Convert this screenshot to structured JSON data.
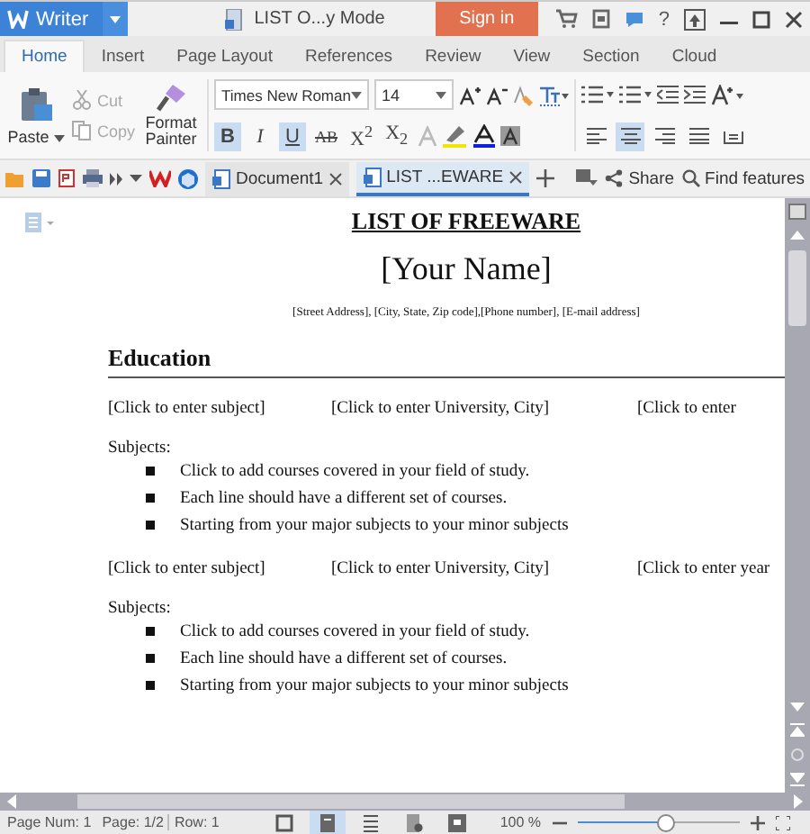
{
  "app": {
    "name": "Writer"
  },
  "title": "LIST O...y Mode",
  "sign_in": "Sign in",
  "help": "?",
  "ribbon_tabs": [
    {
      "label": "Home",
      "selected": true
    },
    {
      "label": "Insert",
      "selected": false
    },
    {
      "label": "Page Layout",
      "selected": false
    },
    {
      "label": "References",
      "selected": false
    },
    {
      "label": "Review",
      "selected": false
    },
    {
      "label": "View",
      "selected": false
    },
    {
      "label": "Section",
      "selected": false
    },
    {
      "label": "Cloud",
      "selected": false
    }
  ],
  "clipboard": {
    "paste": "Paste",
    "cut": {
      "label": "Cut",
      "disabled": true
    },
    "copy": {
      "label": "Copy",
      "disabled": true
    },
    "format_painter": "Format Painter"
  },
  "font": {
    "name": "Times New Roman",
    "size": "14"
  },
  "format_toggles": [
    {
      "kind": "bold",
      "label": "B",
      "selected": true
    },
    {
      "kind": "italic",
      "label": "I",
      "selected": false
    },
    {
      "kind": "underline",
      "label": "U",
      "selected": true
    },
    {
      "kind": "strike",
      "label": "AB",
      "selected": false
    },
    {
      "kind": "superscript",
      "label": "X$^{2}$",
      "selected": false
    },
    {
      "kind": "subscript",
      "label": "X$_{2}$",
      "selected": false
    }
  ],
  "alignment": [
    {
      "kind": "left",
      "selected": false
    },
    {
      "kind": "center",
      "selected": true
    },
    {
      "kind": "right",
      "selected": false
    },
    {
      "kind": "justify",
      "selected": false
    },
    {
      "kind": "distributed",
      "selected": false
    }
  ],
  "doc_tabs": [
    {
      "label": "Document1",
      "selected": false
    },
    {
      "label": "LIST ...EWARE",
      "selected": true
    }
  ],
  "share": "Share",
  "find": "Find features",
  "document": {
    "title": "LIST OF FREEWARE",
    "name": "[Your Name]",
    "contact": "[Street Address], [City, State, Zip code],[Phone number], [E-mail address]",
    "section": "Education",
    "entries": [
      {
        "subject": "[Click to enter subject]",
        "university": "[Click to enter University, City]",
        "year": "[Click to enter",
        "subjects_label": "Subjects:",
        "bullets": [
          "Click to add courses covered in your field of study.",
          "Each line should have a different set of courses.",
          "Starting from your major subjects to your minor subjects"
        ]
      },
      {
        "subject": "[Click to enter subject]",
        "university": "[Click to enter University, City]",
        "year": "[Click to enter year",
        "subjects_label": "Subjects:",
        "bullets": [
          "Click to add courses covered in your field of study.",
          "Each line should have a different set of courses.",
          "Starting from your major subjects to your minor subjects"
        ]
      }
    ]
  },
  "status": {
    "page_num": "Page Num: 1",
    "page": "Page: 1/2",
    "row": "Row: 1",
    "zoom": "100 %",
    "zoom_level": {
      "level": 0.55
    }
  },
  "view_modes": [
    {
      "kind": "fullscreen",
      "selected": false
    },
    {
      "kind": "page",
      "selected": true
    },
    {
      "kind": "outline",
      "selected": false
    },
    {
      "kind": "web",
      "selected": false
    },
    {
      "kind": "reading",
      "selected": false
    }
  ]
}
